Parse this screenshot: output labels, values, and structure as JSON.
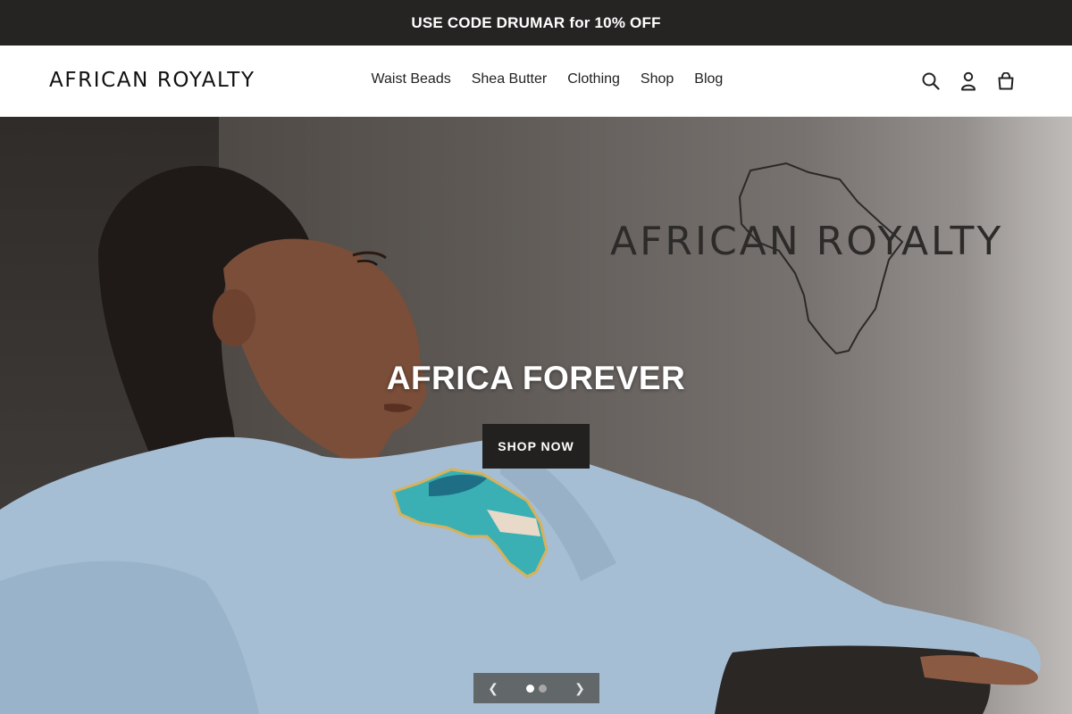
{
  "announcement": {
    "text": "USE CODE DRUMAR for 10% OFF"
  },
  "header": {
    "logo_text": "AFRICAN ROYALTY",
    "nav": [
      {
        "label": "Waist Beads"
      },
      {
        "label": "Shea Butter"
      },
      {
        "label": "Clothing"
      },
      {
        "label": "Shop"
      },
      {
        "label": "Blog"
      }
    ],
    "icons": [
      "search-icon",
      "account-icon",
      "cart-icon"
    ]
  },
  "hero": {
    "watermark": "AFRICAN ROYALTY",
    "sweatshirt_text": "AFRICAN ROYALTY",
    "title": "AFRICA FOREVER",
    "cta_label": "SHOP NOW",
    "slides_total": 2,
    "active_slide": 1
  },
  "colors": {
    "announcement_bg": "#252423",
    "button_bg": "#222120",
    "text": "#222222"
  }
}
